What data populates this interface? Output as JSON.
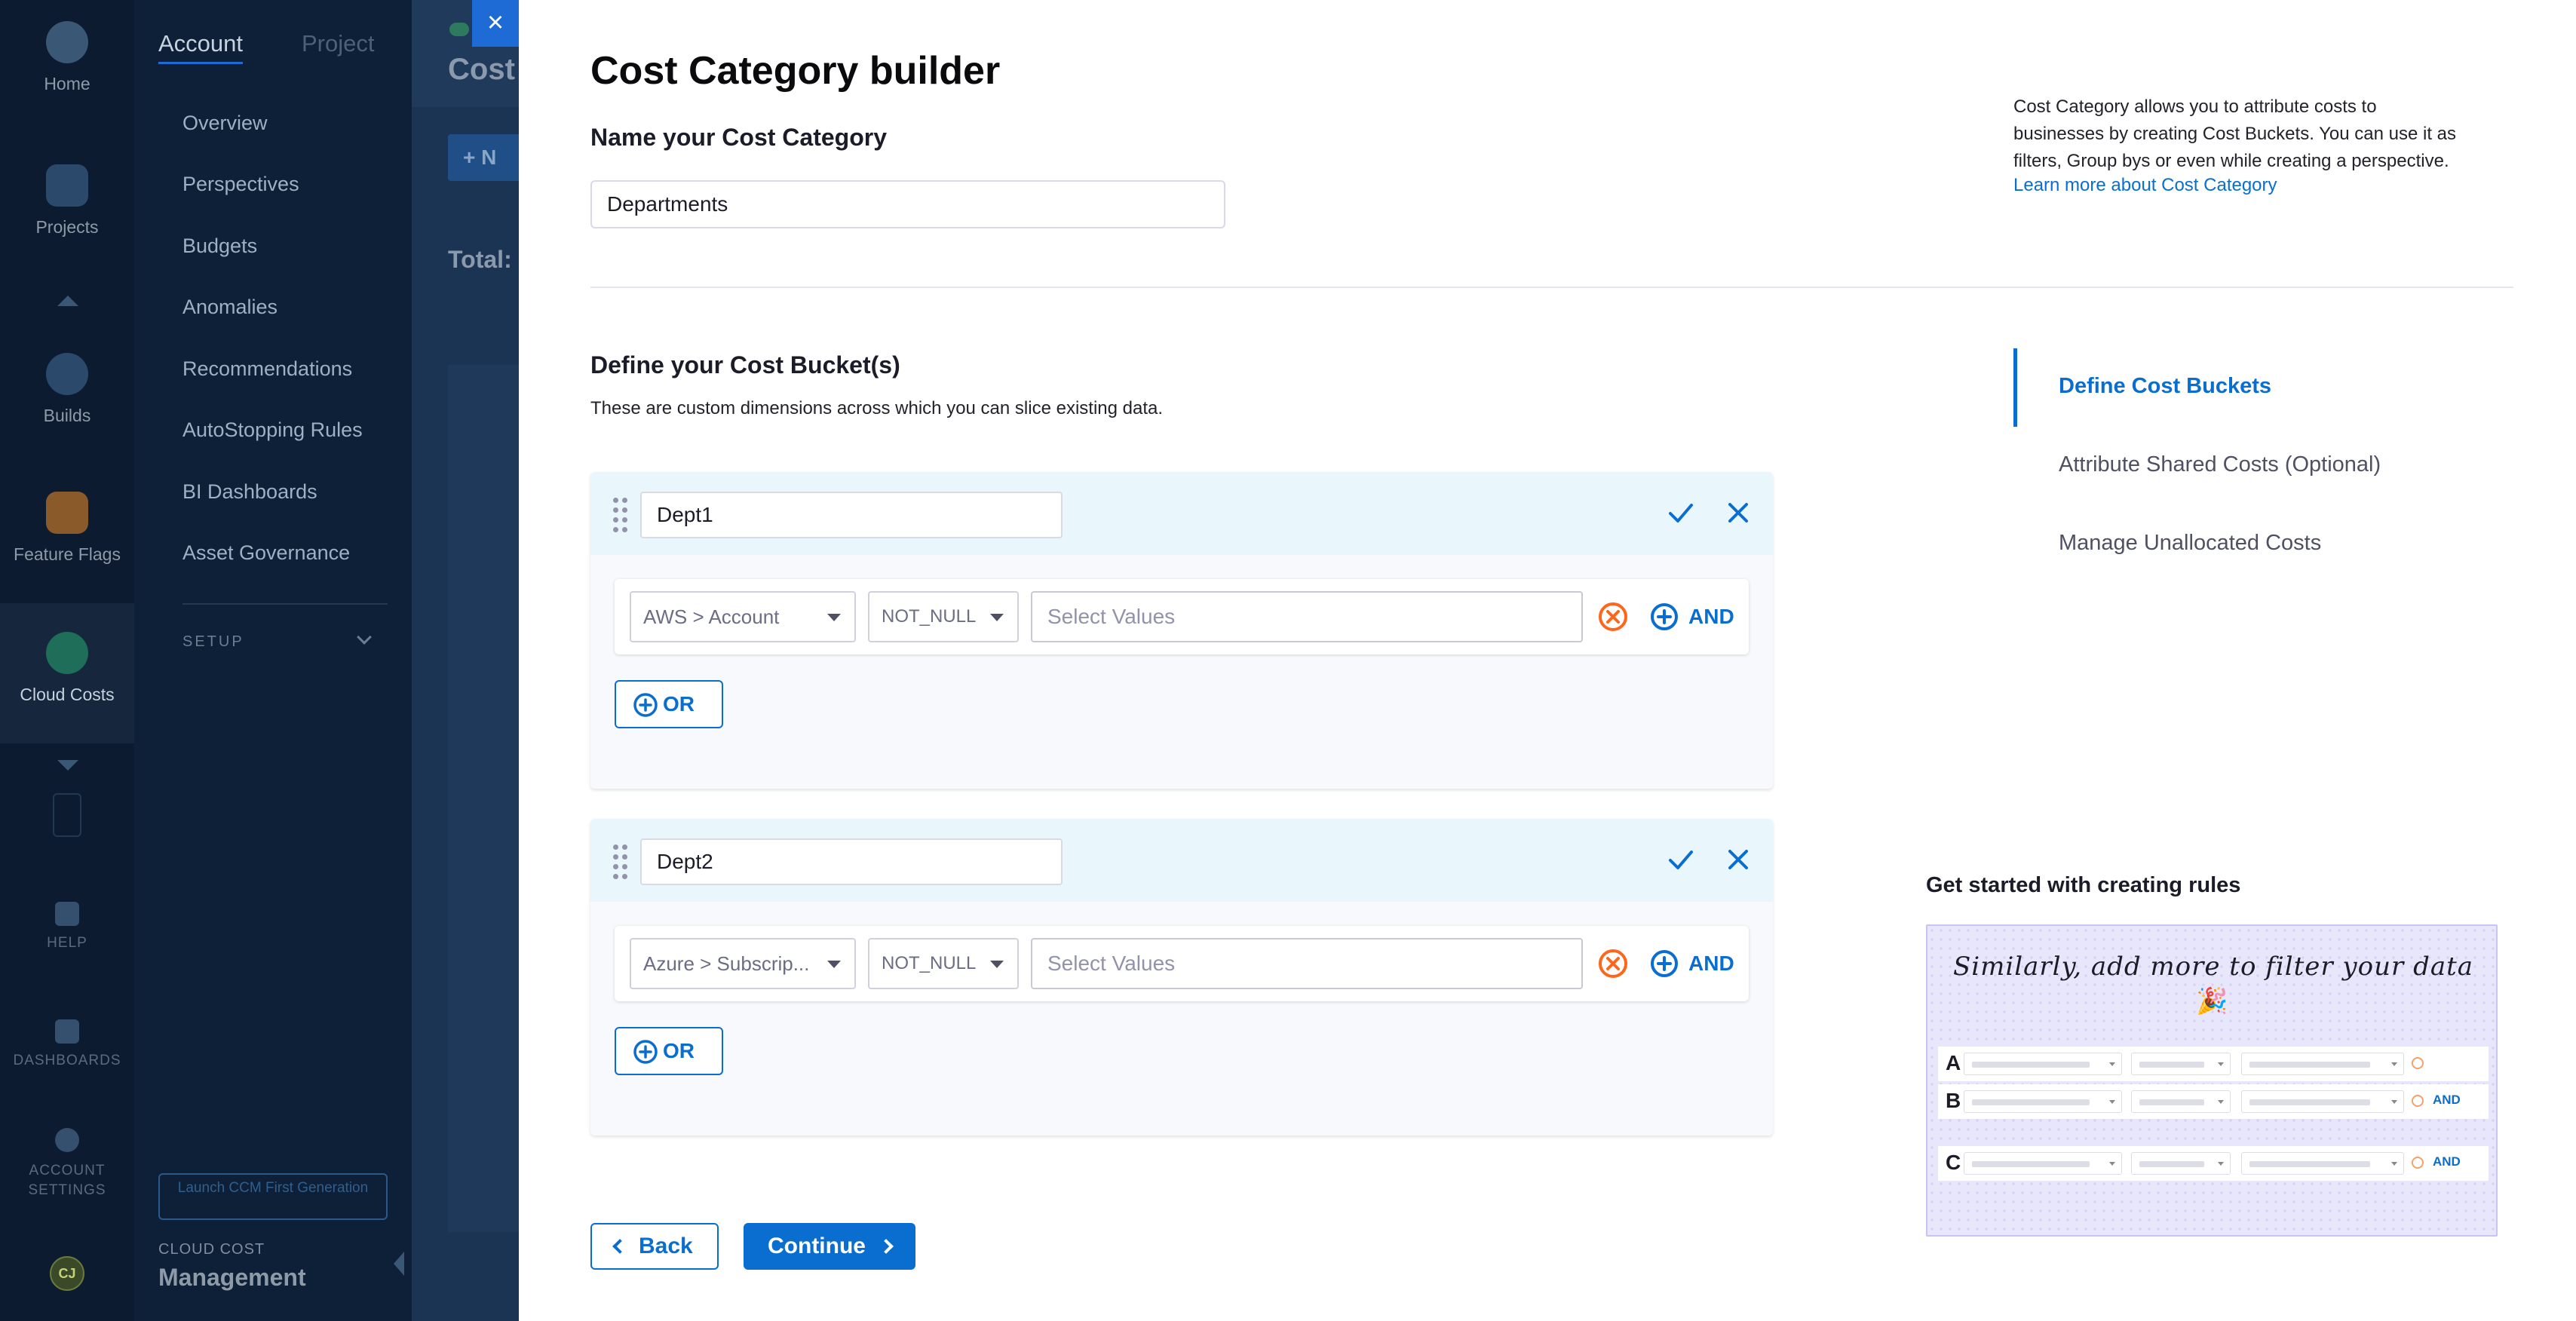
{
  "rail": {
    "items": [
      {
        "label": "Home",
        "icon": "harness-logo-icon"
      },
      {
        "label": "Projects",
        "icon": "cube-icon"
      },
      {
        "label": "Builds",
        "icon": "builds-icon"
      },
      {
        "label": "Feature Flags",
        "icon": "flag-icon"
      },
      {
        "label": "Cloud Costs",
        "icon": "dollar-cloud-icon"
      }
    ],
    "bottom": [
      {
        "label": "HELP",
        "icon": "help-icon"
      },
      {
        "label": "DASHBOARDS",
        "icon": "dashboard-icon"
      },
      {
        "label": "ACCOUNT SETTINGS",
        "icon": "settings-icon"
      }
    ],
    "avatar": "CJ"
  },
  "sidenav": {
    "tabs": [
      "Account",
      "Project"
    ],
    "items": [
      "Overview",
      "Perspectives",
      "Budgets",
      "Anomalies",
      "Recommendations",
      "AutoStopping Rules",
      "BI Dashboards",
      "Asset Governance"
    ],
    "setup": "SETUP",
    "launch": "Launch CCM First Generation",
    "footer_small": "CLOUD COST",
    "footer_big": "Management"
  },
  "bgpage": {
    "title": "Cost",
    "new_btn": "+ N",
    "total": "Total:"
  },
  "drawer": {
    "close_label": "×",
    "title": "Cost Category builder",
    "name_label": "Name your Cost Category",
    "name_value": "Departments",
    "info_text": "Cost Category allows you to attribute costs to businesses by creating Cost Buckets. You can use it as filters, Group bys or even while creating a perspective.",
    "info_link": "Learn more about Cost Category",
    "section_title": "Define your Cost Bucket(s)",
    "section_desc": "These are custom dimensions across which you can slice existing data.",
    "steps": [
      "Define Cost Buckets",
      "Attribute Shared Costs (Optional)",
      "Manage Unallocated Costs"
    ],
    "buckets": [
      {
        "name": "Dept1",
        "field": "AWS > Account",
        "operator": "NOT_NULL",
        "values_placeholder": "Select Values"
      },
      {
        "name": "Dept2",
        "field": "Azure > Subscrip...",
        "operator": "NOT_NULL",
        "values_placeholder": "Select Values"
      }
    ],
    "and_label": "AND",
    "or_label": "OR",
    "back_label": "Back",
    "continue_label": "Continue",
    "getting_started_title": "Get started with creating rules",
    "illustration": {
      "caption": "Similarly, add more to filter your data",
      "party": "🎉",
      "rows": [
        {
          "letter": "A",
          "and": ""
        },
        {
          "letter": "B",
          "and": "AND"
        },
        {
          "letter": "C",
          "and": "AND"
        }
      ]
    }
  },
  "colors": {
    "primary": "#0a6ed1",
    "danger": "#ff661a",
    "rail_bg": "#0c1b30",
    "nav_bg": "#0e2038"
  }
}
